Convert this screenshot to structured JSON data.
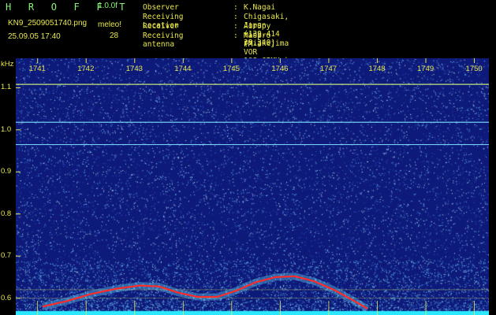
{
  "header": {
    "app_name": "H R O F F T",
    "version": "1.0.0f",
    "filename": "KN9_2509051740.png",
    "timestamp": "25.09.05 17:40",
    "meteor_label": "meleo!",
    "meteor_count": "28"
  },
  "station_info": [
    {
      "key": "Observer",
      "value": "K.Nagai"
    },
    {
      "key": "Receiving Location",
      "value": "Chigasaki, Japan (139.414 35.340)"
    },
    {
      "key": "Receiver",
      "value": "AirSpy mini (Miakejima VOR 108.65MHz)"
    },
    {
      "key": "Receiving antenna",
      "value": "Maspro FM-3"
    }
  ],
  "chart_data": {
    "type": "heatmap",
    "x_axis": {
      "unit": "time (HHMM)",
      "ticks": [
        "1741",
        "1742",
        "1743",
        "1744",
        "1745",
        "1746",
        "1747",
        "1748",
        "1749",
        "1750"
      ],
      "range": [
        1740.55,
        1750.3
      ]
    },
    "y_axis": {
      "unit": "kHz",
      "ticks": [
        "1.1",
        "1.0",
        "0.9",
        "0.8",
        "0.7",
        "0.6"
      ],
      "range": [
        0.56,
        1.17
      ]
    },
    "horizontal_lines_khz": [
      1.108,
      1.018,
      0.965
    ],
    "signal_trace": {
      "color": "#ff2a2a",
      "points": [
        [
          1741.1,
          0.58
        ],
        [
          1741.6,
          0.593
        ],
        [
          1742.1,
          0.61
        ],
        [
          1742.6,
          0.622
        ],
        [
          1743.1,
          0.63
        ],
        [
          1743.5,
          0.628
        ],
        [
          1743.9,
          0.613
        ],
        [
          1744.3,
          0.603
        ],
        [
          1744.7,
          0.603
        ],
        [
          1745.1,
          0.618
        ],
        [
          1745.5,
          0.638
        ],
        [
          1745.9,
          0.65
        ],
        [
          1746.3,
          0.652
        ],
        [
          1746.7,
          0.64
        ],
        [
          1747.1,
          0.62
        ],
        [
          1747.5,
          0.595
        ],
        [
          1747.8,
          0.575
        ]
      ]
    },
    "colors": {
      "background": "#0e1a7a",
      "noise": "#6fd0ff",
      "grid": "#e8e84a",
      "baseline": "#2be8ff"
    }
  }
}
